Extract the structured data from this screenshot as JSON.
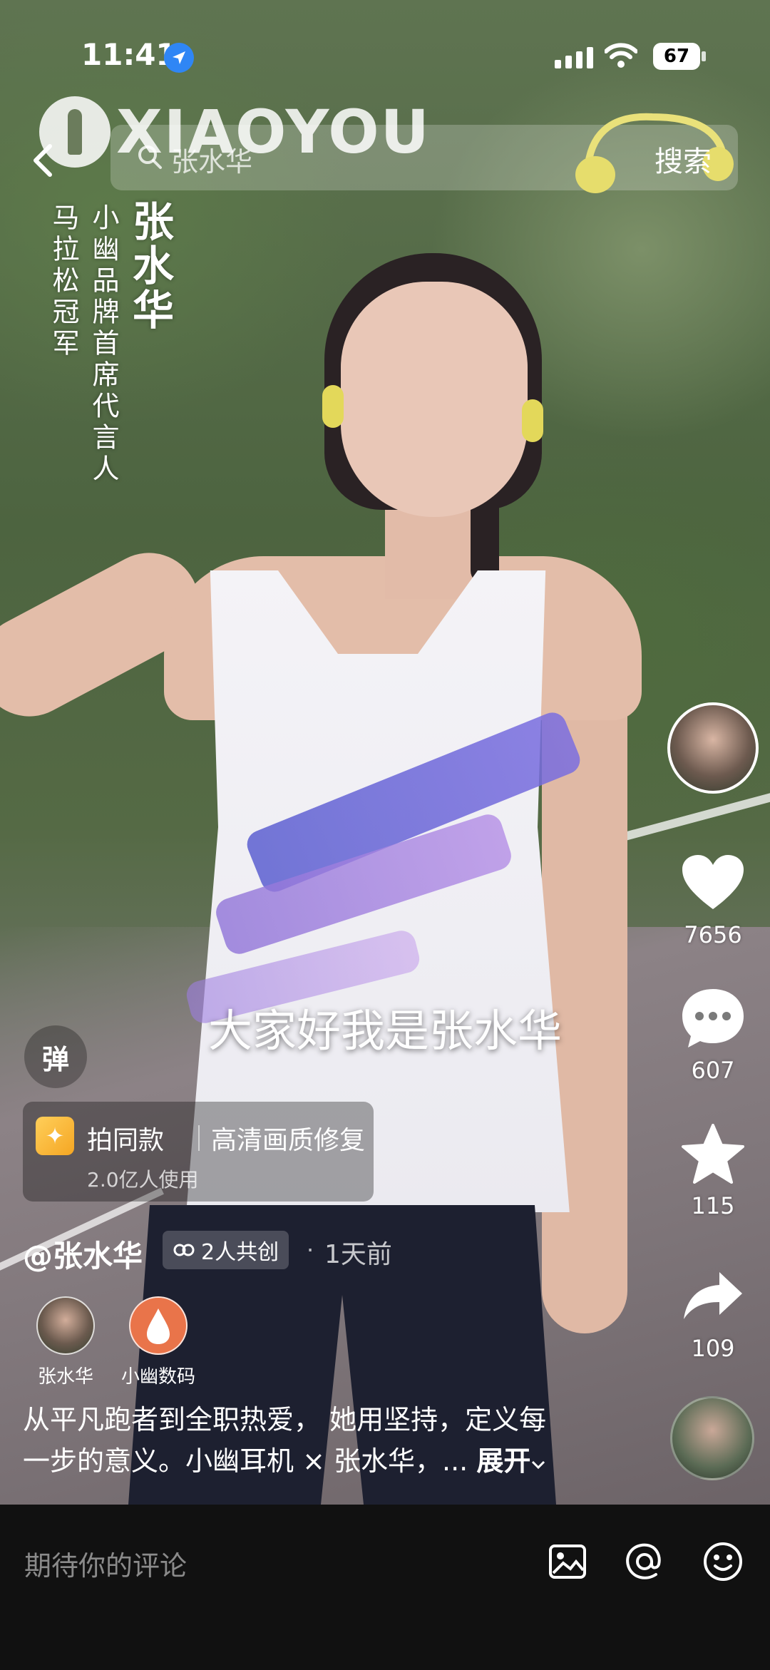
{
  "status_bar": {
    "time": "11:41",
    "battery": "67"
  },
  "top_bar": {
    "brand_watermark": "XIAOYOU",
    "search_query": "张水华",
    "search_button": "搜索"
  },
  "overlay_text": {
    "name": "张水华",
    "role": "小幽品牌首席代言人",
    "title": "马拉松冠军"
  },
  "subtitle": "大家好我是张水华",
  "danmu_label": "弹",
  "right_rail": {
    "likes": "7656",
    "comments": "607",
    "favorites": "115",
    "shares": "109"
  },
  "template_card": {
    "primary": "拍同款",
    "secondary": "高清画质修复",
    "usage": "2.0亿人使用"
  },
  "post": {
    "author": "@张水华",
    "cocreate": "2人共创",
    "time_ago": "1天前",
    "creators": [
      {
        "name": "张水华"
      },
      {
        "name": "小幽数码"
      }
    ],
    "description_line1": "从平凡跑者到全职热爱， 她用坚持，定义每",
    "description_line2": "一步的意义。小幽耳机 × 张水华，...",
    "expand_label": "展开"
  },
  "comment_bar": {
    "placeholder": "期待你的评论"
  },
  "colors": {
    "location_blue": "#2f86f5",
    "accent_yellow": "#f5a623"
  }
}
